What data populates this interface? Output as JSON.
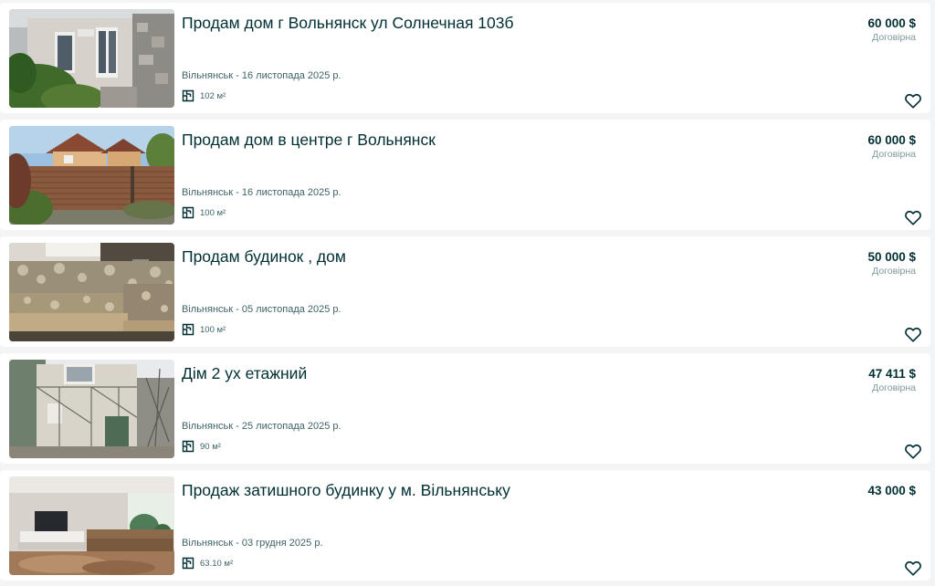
{
  "listings": [
    {
      "title": "Продам дом г Вольнянск ул Солнечная 103б",
      "location_date": "Вільнянськ - 16 листопада 2025 р.",
      "area": "102 м²",
      "price": "60 000 $",
      "negotiable": "Договірна",
      "photo": "house-facade-photo"
    },
    {
      "title": "Продам дом в центре г Вольнянск",
      "location_date": "Вільнянськ - 16 листопада 2025 р.",
      "area": "100 м²",
      "price": "60 000 $",
      "negotiable": "Договірна",
      "photo": "house-fence-photo"
    },
    {
      "title": "Продам будинок , дом",
      "location_date": "Вільнянськ - 05 листопада 2025 р.",
      "area": "100 м²",
      "price": "50 000 $",
      "negotiable": "Договірна",
      "photo": "sofa-interior-photo"
    },
    {
      "title": "Дім 2 ух етажний",
      "location_date": "Вільнянськ - 25 листопада 2025 р.",
      "area": "90 м²",
      "price": "47 411 $",
      "negotiable": "Договірна",
      "photo": "two-storey-house-photo"
    },
    {
      "title": "Продаж затишного будинку у м. Вільнянську",
      "location_date": "Вільнянськ - 03 грудня 2025 р.",
      "area": "63.10 м²",
      "price": "43 000 $",
      "negotiable": "",
      "photo": "living-room-photo"
    }
  ],
  "icons": {
    "area": "floor-plan-icon",
    "favorite": "heart-outline-icon"
  },
  "colors": {
    "text": "#002f34",
    "muted": "#406367",
    "background": "#f2f4f5",
    "card": "#ffffff"
  }
}
